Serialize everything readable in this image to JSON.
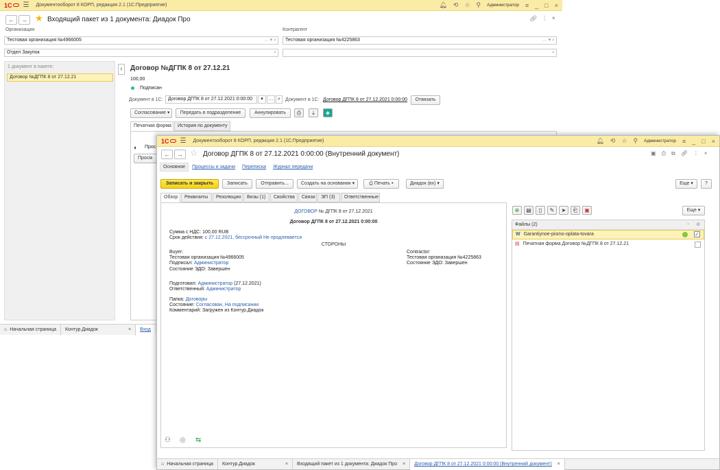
{
  "w1": {
    "title": "Документооборот 8 КОРП, редакция 2.1  (1С:Предприятие)",
    "user": "Администратор",
    "heading": "Входящий пакет из 1 документа: Диадок Про",
    "org_label": "Организация",
    "org_value": "Тестовая организация №4966005",
    "contr_label": "Контрагент",
    "contr_value": "Тестовая организация №4225863",
    "dept_value": "Отдел Закупок",
    "pkg_label": "1 документ в пакете:",
    "pkg_item": "Договор №ДГПК 8 от 27.12.21",
    "doc_title": "Договор №ДГПК 8 от 27.12.21",
    "amount": "100,00",
    "status": "Подписан",
    "doc1c_label": "Документ в 1С:",
    "doc1c_value": "Договор ДГПК 8 от 27.12.2021 0:00:00",
    "doc1c_label2": "Документ в 1С:",
    "doc1c_link": "Договор ДГПК 8 от 27.12.2021 0:00:00",
    "unlink_btn": "Отвязать",
    "approve_btn": "Согласование",
    "transfer_btn": "Передать в подразделение",
    "annul_btn": "Аннулировать",
    "tab_print": "Печатная форма",
    "tab_history": "История по документу",
    "preview_text": "Прос",
    "preview_btn": "Просм",
    "taskbar": {
      "home": "Начальная страница",
      "tab1": "Контур.Диадок",
      "tab2": "Вход"
    }
  },
  "w2": {
    "title": "Документооборот 8 КОРП, редакция 2.1  (1С:Предприятие)",
    "user": "Администратор",
    "heading": "Договор ДГПК 8 от 27.12.2021 0:00:00 (Внутренний документ)",
    "nav": [
      "Основное",
      "Процессы и задачи",
      "Переписка",
      "Журнал передачи"
    ],
    "toolbar": {
      "save_close": "Записать и закрыть",
      "save": "Записать",
      "send": "Отправить...",
      "create_basis": "Создать на основании",
      "print": "Печать",
      "diadoc": "Диадок (вх)",
      "more": "Еще",
      "help": "?"
    },
    "tabs": [
      "Обзор",
      "Реквизиты",
      "Резолюции",
      "Визы (1)",
      "Свойства",
      "Связи",
      "ЭП (3)",
      "Ответственные"
    ],
    "overview": {
      "doc_link": "ДОГОВОР",
      "doc_num": "№ ДГПК 8 от 27.12.2021",
      "doc_subtitle": "Договор ДГПК 8 от 27.12.2021 0:00:00",
      "sum_label": "Сумма с НДС:",
      "sum_value": "100,00 RUB",
      "term_label": "Срок действия:",
      "term_value": "с 27.12.2021, бессрочный Не продлевается",
      "parties": "СТОРОНЫ",
      "buyer_label": "Buyer:",
      "buyer_org": "Тестовая организация №4966005",
      "buyer_signed_label": "Подписал:",
      "buyer_signed": "Администратор",
      "buyer_edo": "Состояние ЭДО: Завершен",
      "contr_label": "Contractor:",
      "contr_org": "Тестовая организация №4225863",
      "contr_edo": "Состояние ЭДО: Завершен",
      "prepared_label": "Подготовил:",
      "prepared_value": "Администратор",
      "prepared_date": "(27.12.2021)",
      "resp_label": "Ответственный:",
      "resp_value": "Администратор",
      "folder_label": "Папка:",
      "folder_value": "Договоры",
      "state_label": "Состояние:",
      "state_value": "Согласован, На подписании",
      "comment": "Комментарий: Загружен из Контур.Диадок"
    },
    "files": {
      "more": "Еще",
      "header": "Файлы (2)",
      "items": [
        {
          "name": "Garantiynoe-pismo-oplata-tovara",
          "checked": true
        },
        {
          "name": "Печатная форма Договор №ДГПК 8 от 27.12.21",
          "checked": false
        }
      ]
    },
    "taskbar": {
      "home": "Начальная страница",
      "tab1": "Контур.Диадок",
      "tab2": "Входящий пакет из 1 документа: Диадок Про",
      "tab3": "Договор ДГПК 8 от 27.12.2021 0:00:00 (Внутренний документ)"
    }
  },
  "colors": {
    "titlebar": "#fbeca5",
    "primary": "#f4d21a",
    "link": "#2a5db0",
    "selected_row": "#fdf3b8"
  }
}
